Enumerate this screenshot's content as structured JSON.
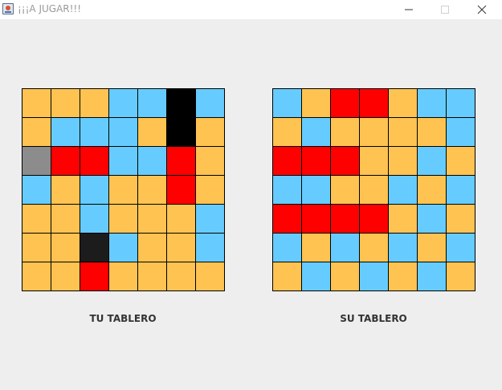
{
  "window": {
    "title": "¡¡¡A JUGAR!!!",
    "icon": "java-app-icon",
    "controls": [
      "minimize-icon",
      "maximize-icon",
      "close-icon"
    ]
  },
  "colors": {
    "O": "#ffc352",
    "B": "#66ccff",
    "R": "#ff0000",
    "K": "#000000",
    "D": "#1c1c1c",
    "G": "#8c8c8c"
  },
  "boards": [
    {
      "label": "TU TABLERO",
      "rows": [
        [
          "O",
          "O",
          "O",
          "B",
          "B",
          "K",
          "B"
        ],
        [
          "O",
          "B",
          "B",
          "B",
          "O",
          "K",
          "O"
        ],
        [
          "G",
          "R",
          "R",
          "B",
          "B",
          "R",
          "O"
        ],
        [
          "B",
          "O",
          "B",
          "O",
          "O",
          "R",
          "O"
        ],
        [
          "O",
          "O",
          "B",
          "O",
          "O",
          "O",
          "B"
        ],
        [
          "O",
          "O",
          "D",
          "B",
          "O",
          "O",
          "B"
        ],
        [
          "O",
          "O",
          "R",
          "O",
          "O",
          "O",
          "O"
        ]
      ]
    },
    {
      "label": "SU TABLERO",
      "rows": [
        [
          "B",
          "O",
          "R",
          "R",
          "O",
          "B",
          "B"
        ],
        [
          "O",
          "B",
          "O",
          "O",
          "O",
          "O",
          "B"
        ],
        [
          "R",
          "R",
          "R",
          "O",
          "O",
          "B",
          "O"
        ],
        [
          "B",
          "B",
          "O",
          "O",
          "B",
          "O",
          "B"
        ],
        [
          "R",
          "R",
          "R",
          "R",
          "O",
          "B",
          "O"
        ],
        [
          "B",
          "O",
          "B",
          "O",
          "B",
          "O",
          "B"
        ],
        [
          "O",
          "B",
          "O",
          "B",
          "O",
          "B",
          "O"
        ]
      ]
    }
  ]
}
